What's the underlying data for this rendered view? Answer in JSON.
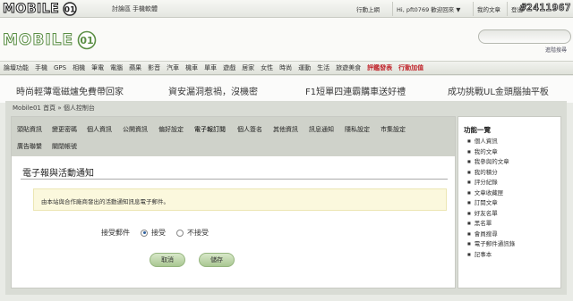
{
  "top": {
    "logo_text": "MOBILE",
    "tabs": [
      "討論區",
      "手機軟體"
    ],
    "right_links": [
      "行動上網",
      "Hi, pft0769 歡迎回來 ▼",
      "我的文章",
      "登出"
    ],
    "watermark": "#2411967"
  },
  "header": {
    "logo_text": "MOBILE",
    "search_placeholder": "",
    "search_link": "進階搜尋"
  },
  "nav": {
    "items": [
      "論壇功能",
      "手機",
      "GPS",
      "相機",
      "筆電",
      "電腦",
      "蘋果",
      "影音",
      "汽車",
      "機車",
      "單車",
      "遊戲",
      "居家",
      "女性",
      "時尚",
      "運動",
      "生活",
      "旅遊美食"
    ],
    "hot_items": [
      "評鑑發表",
      "行動加值"
    ]
  },
  "promo": {
    "items": [
      "時尚輕薄電磁爐免費帶回家",
      "資安漏洞惹禍，沒機密",
      "F1短單四連霸購車送好禮",
      "成功挑戰UL金頭腦抽平板"
    ]
  },
  "breadcrumb": "Mobile01 首頁 » 個人控制台",
  "tabs": {
    "row1": [
      "頭貼資訊",
      "變更密碼",
      "個人資訊",
      "公開資訊",
      "偏好設定",
      "電子報訂閱",
      "個人簽名",
      "其他資訊",
      "訊息通知",
      "隱私設定",
      "市集設定"
    ],
    "row2": [
      "廣告聯繫",
      "關閉帳號"
    ]
  },
  "section": {
    "title": "電子報與活動通知",
    "notice": "由本站與合作廠商發出的活動通知訊息電子郵件。",
    "label": "接受郵件",
    "option_yes": "接受",
    "option_no": "不接受",
    "selected": "接受",
    "cancel_label": "取消",
    "save_label": "儲存"
  },
  "sidebar": {
    "title": "功能一覽",
    "items": [
      "個人資訊",
      "我的文章",
      "我參與的文章",
      "我的積分",
      "評分紀錄",
      "文章收藏匣",
      "訂閱文章",
      "好友名單",
      "黑名單",
      "會員搜尋",
      "電子郵件通訊錄",
      "記事本"
    ]
  },
  "colors": {
    "accent_green": "#a9c792",
    "hot_red": "#c0242b",
    "notice_bg": "#fbf8dd"
  }
}
